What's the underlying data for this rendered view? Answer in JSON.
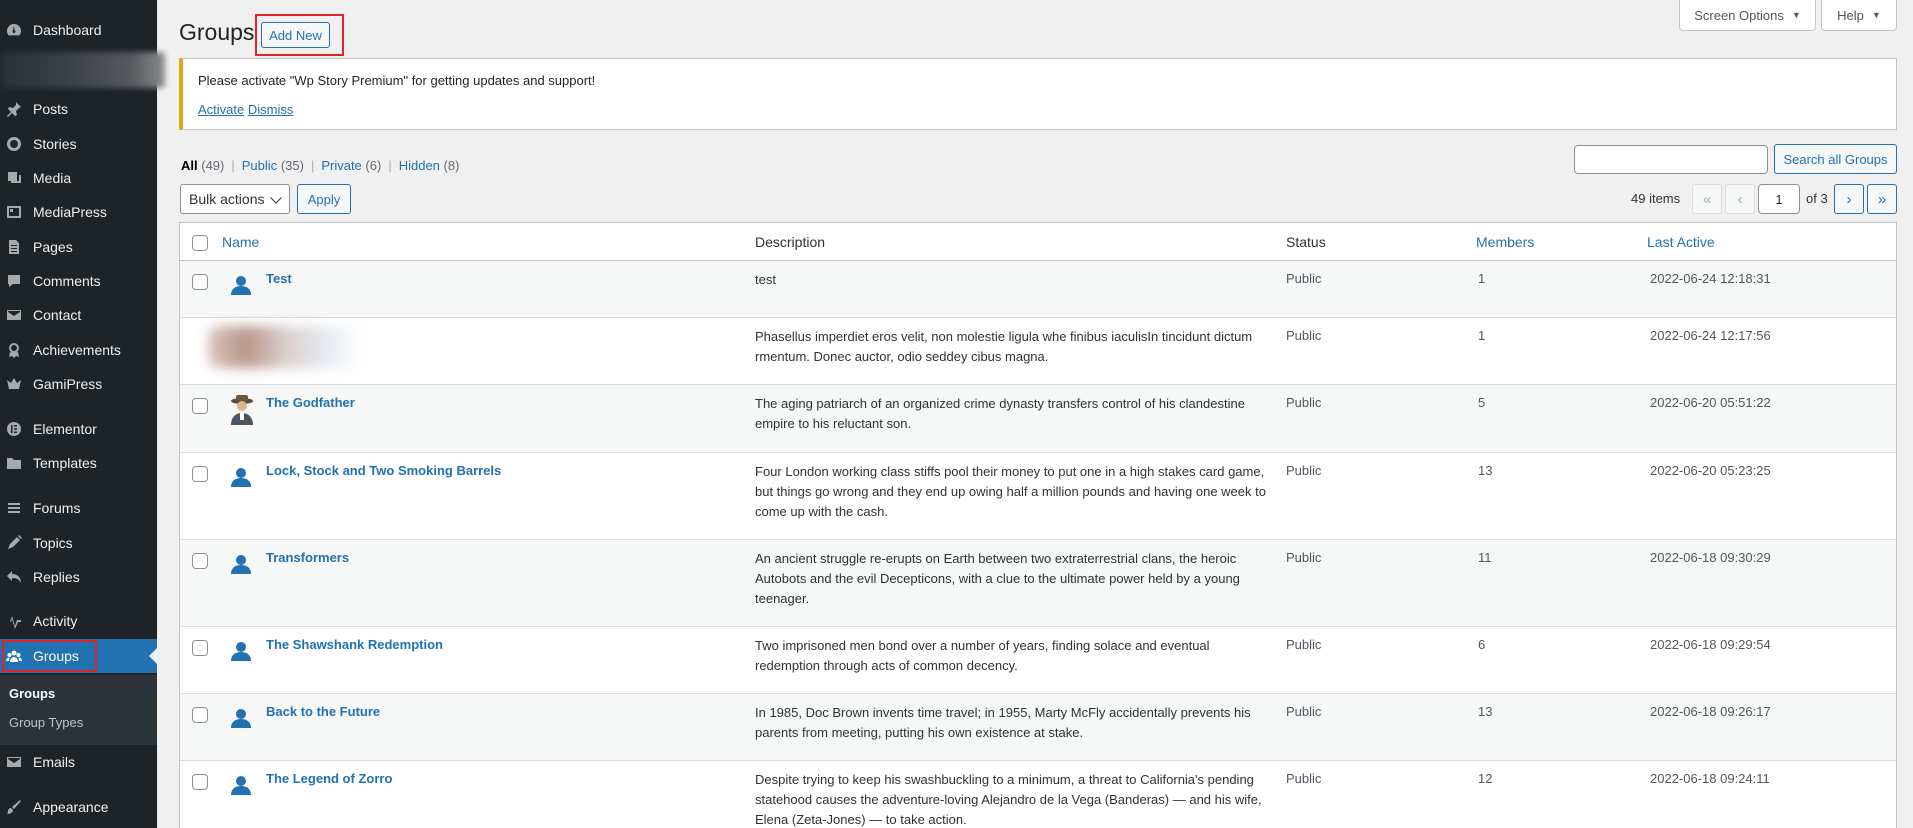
{
  "sidebar": {
    "items": [
      {
        "label": "Dashboard",
        "icon": "dashboard-icon"
      },
      {
        "label": "Posts",
        "icon": "pin-icon"
      },
      {
        "label": "Stories",
        "icon": "stories-icon"
      },
      {
        "label": "Media",
        "icon": "media-icon"
      },
      {
        "label": "MediaPress",
        "icon": "mediapress-icon"
      },
      {
        "label": "Pages",
        "icon": "pages-icon"
      },
      {
        "label": "Comments",
        "icon": "comments-icon"
      },
      {
        "label": "Contact",
        "icon": "mail-icon"
      },
      {
        "label": "Achievements",
        "icon": "award-icon"
      },
      {
        "label": "GamiPress",
        "icon": "crown-icon"
      },
      {
        "label": "Elementor",
        "icon": "elementor-icon"
      },
      {
        "label": "Templates",
        "icon": "folder-icon"
      },
      {
        "label": "Forums",
        "icon": "forums-icon"
      },
      {
        "label": "Topics",
        "icon": "topics-icon"
      },
      {
        "label": "Replies",
        "icon": "replies-icon"
      },
      {
        "label": "Activity",
        "icon": "activity-icon"
      },
      {
        "label": "Groups",
        "icon": "groups-icon"
      },
      {
        "label": "Emails",
        "icon": "mail-icon"
      },
      {
        "label": "Appearance",
        "icon": "brush-icon"
      }
    ],
    "submenu": [
      "Groups",
      "Group Types"
    ]
  },
  "header": {
    "screen_options": "Screen Options",
    "help": "Help",
    "title": "Groups",
    "add_new": "Add New"
  },
  "notice": {
    "message": "Please activate \"Wp Story Premium\" for getting updates and support!",
    "activate": "Activate",
    "dismiss": "Dismiss"
  },
  "filters": [
    {
      "label": "All",
      "count": "(49)"
    },
    {
      "label": "Public",
      "count": "(35)"
    },
    {
      "label": "Private",
      "count": "(6)"
    },
    {
      "label": "Hidden",
      "count": "(8)"
    }
  ],
  "search": {
    "button": "Search all Groups",
    "value": ""
  },
  "bulk": {
    "selected": "Bulk actions",
    "apply": "Apply"
  },
  "pagination": {
    "items": "49 items",
    "first": "«",
    "prev": "‹",
    "current": "1",
    "of": "of 3",
    "next": "›",
    "last": "»"
  },
  "table": {
    "columns": {
      "name": "Name",
      "description": "Description",
      "status": "Status",
      "members": "Members",
      "last_active": "Last Active"
    },
    "rows": [
      {
        "name": "Test",
        "description": "test",
        "status": "Public",
        "members": "1",
        "last_active": "2022-06-24 12:18:31"
      },
      {
        "name": "",
        "description": "Phasellus imperdiet eros velit, non molestie ligula whe finibus iaculisIn tincidunt dictum rmentum. Donec auctor, odio seddey cibus magna.",
        "status": "Public",
        "members": "1",
        "last_active": "2022-06-24 12:17:56"
      },
      {
        "name": "The Godfather",
        "description": "The aging patriarch of an organized crime dynasty transfers control of his clandestine empire to his reluctant son.",
        "status": "Public",
        "members": "5",
        "last_active": "2022-06-20 05:51:22"
      },
      {
        "name": "Lock, Stock and Two Smoking Barrels",
        "description": "Four London working class stiffs pool their money to put one in a high stakes card game, but things go wrong and they end up owing half a million pounds and having one week to come up with the cash.",
        "status": "Public",
        "members": "13",
        "last_active": "2022-06-20 05:23:25"
      },
      {
        "name": "Transformers",
        "description": "An ancient struggle re-erupts on Earth between two extraterrestrial clans, the heroic Autobots and the evil Decepticons, with a clue to the ultimate power held by a young teenager.",
        "status": "Public",
        "members": "11",
        "last_active": "2022-06-18 09:30:29"
      },
      {
        "name": "The Shawshank Redemption",
        "description": "Two imprisoned men bond over a number of years, finding solace and eventual redemption through acts of common decency.",
        "status": "Public",
        "members": "6",
        "last_active": "2022-06-18 09:29:54"
      },
      {
        "name": "Back to the Future",
        "description": "In 1985, Doc Brown invents time travel; in 1955, Marty McFly accidentally prevents his parents from meeting, putting his own existence at stake.",
        "status": "Public",
        "members": "13",
        "last_active": "2022-06-18 09:26:17"
      },
      {
        "name": "The Legend of Zorro",
        "description": "Despite trying to keep his swashbuckling to a minimum, a threat to California's pending statehood causes the adventure-loving Alejandro de la Vega (Banderas) — and his wife, Elena (Zeta-Jones) — to take action.",
        "status": "Public",
        "members": "12",
        "last_active": "2022-06-18 09:24:11"
      }
    ]
  },
  "colors": {
    "accent": "#2271b1",
    "sidebar": "#1d2327",
    "notice_warning": "#dba617",
    "highlight": "#e0242e"
  }
}
